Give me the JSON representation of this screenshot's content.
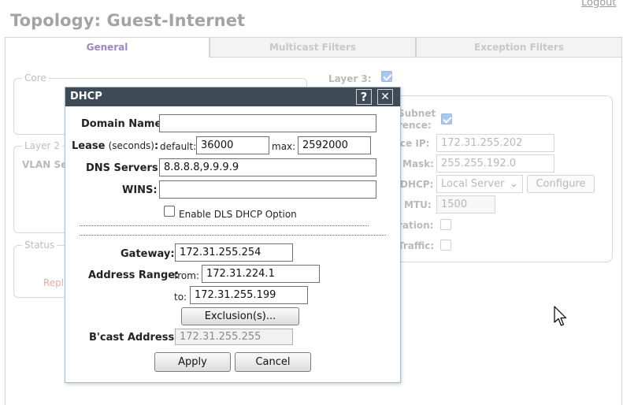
{
  "header": {
    "logout": "Logout",
    "title": "Topology: Guest-Internet"
  },
  "tabs": [
    {
      "label": "General",
      "active": true
    },
    {
      "label": "Multicast Filters",
      "active": false
    },
    {
      "label": "Exception Filters",
      "active": false
    }
  ],
  "background": {
    "core_legend": "Core",
    "layer2_legend": "Layer 2",
    "vlan_label": "VLAN Se",
    "status_legend": "Status",
    "status_text": "Repl",
    "layer3_label": "Layer 3:",
    "layer3_checked": true,
    "subnet_label_1": "Subnet",
    "subnet_label_2": "rence:",
    "subnet_checked": true,
    "iface_ip_label": "ce IP:",
    "iface_ip_value": "172.31.255.202",
    "mask_label": "Mask:",
    "mask_value": "255.255.192.0",
    "dhcp_label": "DHCP:",
    "dhcp_select": "Local Server",
    "configure_button": "Configure",
    "mtu_label": "MTU:",
    "mtu_value": "1500",
    "ration_label": "ration:",
    "traffic_label": "Traffic:"
  },
  "dialog": {
    "title": "DHCP",
    "help_icon": "?",
    "close_icon": "✕",
    "domain_name_label": "Domain Name:",
    "domain_name_value": "",
    "lease_label": "Lease",
    "lease_unit": "(seconds)",
    "lease_colon": ":",
    "lease_default_label": "default:",
    "lease_default_value": "36000",
    "lease_max_label": "max:",
    "lease_max_value": "2592000",
    "dns_label": "DNS Servers:",
    "dns_value": "8.8.8.8,9.9.9.9",
    "wins_label": "WINS:",
    "wins_value": "",
    "dls_option_label": "Enable DLS DHCP Option",
    "dls_option_checked": false,
    "gateway_label": "Gateway:",
    "gateway_value": "172.31.255.254",
    "range_label": "Address Range:",
    "range_from_label": "from:",
    "range_from_value": "172.31.224.1",
    "range_to_label": "to:",
    "range_to_value": "172.31.255.199",
    "exclusions_button": "Exclusion(s)...",
    "bcast_label": "B'cast Address:",
    "bcast_value": "172.31.255.255",
    "apply_button": "Apply",
    "cancel_button": "Cancel"
  },
  "colors": {
    "title_bar": "#3e4a56",
    "active_tab": "#9b86c9"
  }
}
